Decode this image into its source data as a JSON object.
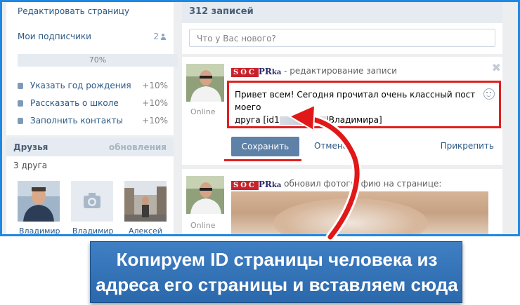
{
  "sidebar": {
    "edit_page": "Редактировать страницу",
    "subscribers_label": "Мои подписчики",
    "subscribers_count": "2",
    "progress_text": "70%",
    "progress_value": 0.7,
    "tasks": [
      {
        "label": "Указать год рождения",
        "value": "+10%"
      },
      {
        "label": "Рассказать о школе",
        "value": "+10%"
      },
      {
        "label": "Заполнить контакты",
        "value": "+10%"
      }
    ],
    "friends_title": "Друзья",
    "friends_updates": "обновления",
    "friends_count": "3 друга",
    "friends": [
      {
        "name": "Владимир"
      },
      {
        "name": "Владимир"
      },
      {
        "name": "Алексей"
      }
    ]
  },
  "wall": {
    "records_count": "312 записей",
    "new_post_placeholder": "Что у Вас нового?",
    "post1": {
      "logo_a": "SOC",
      "logo_b": "PR",
      "logo_c": "ka",
      "subtitle": " - редактирование записи",
      "status": "Online",
      "text_line1": "Привет всем! Сегодня прочитал очень классный пост моего",
      "text_line2_a": "друга [id1",
      "text_line2_b": "|Владимира]",
      "save_label": "Сохранить",
      "cancel_label": "Отмена",
      "attach_label": "Прикрепить",
      "close_symbol": "✖"
    },
    "post2": {
      "logo_a": "SOC",
      "logo_b": "PR",
      "logo_c": "ka",
      "subtitle": " обновил фотографию на странице:",
      "status": "Online"
    }
  },
  "banner": {
    "line1": "Копируем ID страницы человека из",
    "line2": "адреса его страницы и вставляем сюда"
  },
  "colors": {
    "frame_border": "#1e88e5",
    "highlight_red": "#e02020",
    "banner_blue": "#2b68ac",
    "save_button": "#5e81a8"
  }
}
